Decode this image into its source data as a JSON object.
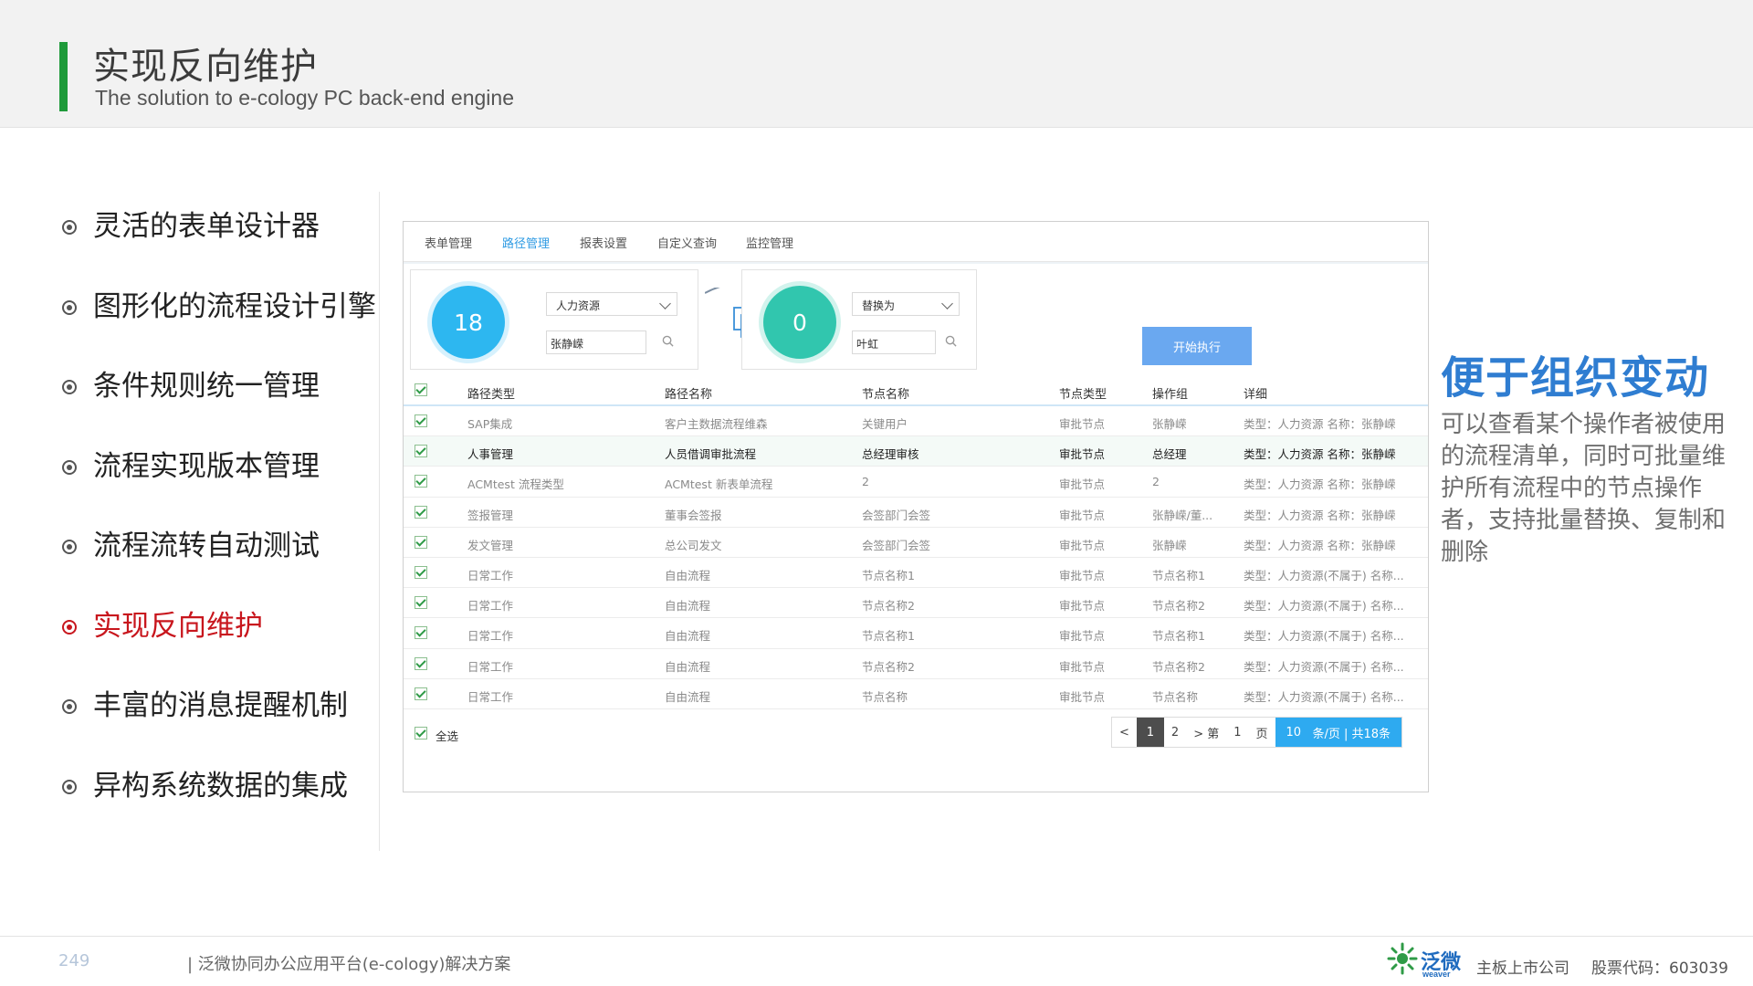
{
  "header": {
    "title": "实现反向维护",
    "subtitle": "The solution to e-cology PC back-end engine"
  },
  "menu": {
    "items": [
      {
        "label": "灵活的表单设计器",
        "active": false
      },
      {
        "label": "图形化的流程设计引擎",
        "active": false
      },
      {
        "label": "条件规则统一管理",
        "active": false
      },
      {
        "label": "流程实现版本管理",
        "active": false
      },
      {
        "label": "流程流转自动测试",
        "active": false
      },
      {
        "label": "实现反向维护",
        "active": true
      },
      {
        "label": "丰富的消息提醒机制",
        "active": false
      },
      {
        "label": "异构系统数据的集成",
        "active": false
      }
    ]
  },
  "app": {
    "tabs": [
      {
        "label": "表单管理",
        "active": false
      },
      {
        "label": "路径管理",
        "active": true
      },
      {
        "label": "报表设置",
        "active": false
      },
      {
        "label": "自定义查询",
        "active": false
      },
      {
        "label": "监控管理",
        "active": false
      }
    ],
    "source": {
      "count": "18",
      "select": "人力资源",
      "input": "张静嵘"
    },
    "target": {
      "count": "0",
      "select": "替换为",
      "input": "叶虹"
    },
    "execute_label": "开始执行",
    "columns": [
      "路径类型",
      "路径名称",
      "节点名称",
      "节点类型",
      "操作组",
      "详细"
    ],
    "rows": [
      [
        "SAP集成",
        "客户主数据流程维森",
        "关键用户",
        "审批节点",
        "张静嵘",
        "类型：人力资源  名称：张静嵘"
      ],
      [
        "人事管理",
        "人员借调审批流程",
        "总经理审核",
        "审批节点",
        "总经理",
        "类型：人力资源  名称：张静嵘"
      ],
      [
        "ACMtest 流程类型",
        "ACMtest 新表单流程",
        "2",
        "审批节点",
        "2",
        "类型：人力资源  名称：张静嵘"
      ],
      [
        "签报管理",
        "董事会签报",
        "会签部门会签",
        "审批节点",
        "张静嵘/董...",
        "类型：人力资源  名称：张静嵘"
      ],
      [
        "发文管理",
        "总公司发文",
        "会签部门会签",
        "审批节点",
        "张静嵘",
        "类型：人力资源  名称：张静嵘"
      ],
      [
        "日常工作",
        "自由流程",
        "节点名称1",
        "审批节点",
        "节点名称1",
        "类型：人力资源(不属于)  名称..."
      ],
      [
        "日常工作",
        "自由流程",
        "节点名称2",
        "审批节点",
        "节点名称2",
        "类型：人力资源(不属于)  名称..."
      ],
      [
        "日常工作",
        "自由流程",
        "节点名称1",
        "审批节点",
        "节点名称1",
        "类型：人力资源(不属于)  名称..."
      ],
      [
        "日常工作",
        "自由流程",
        "节点名称2",
        "审批节点",
        "节点名称2",
        "类型：人力资源(不属于)  名称..."
      ],
      [
        "日常工作",
        "自由流程",
        "节点名称",
        "审批节点",
        "节点名称",
        "类型：人力资源(不属于)  名称..."
      ]
    ],
    "select_all_label": "全选",
    "pager": {
      "prev": "<",
      "page1": "1",
      "page2": "2",
      "next": "> 第",
      "jump": "1",
      "page_unit": "页",
      "size": "10",
      "size_label": "条/页 | 共18条"
    }
  },
  "right": {
    "title": "便于组织变动",
    "description": "可以查看某个操作者被使用的流程清单，同时可批量维护所有流程中的节点操作者，支持批量替换、复制和删除"
  },
  "footer": {
    "page_number": "249",
    "text": "| 泛微协同办公应用平台(e-cology)解决方案",
    "logo_text": "泛微",
    "logo_sub": "weaver",
    "company": "主板上市公司",
    "stock": "股票代码：603039"
  },
  "colors": {
    "accent_green": "#1f9a3a",
    "active_red": "#c8161d",
    "tab_blue": "#2f9be3",
    "title_blue": "#2f7dd1"
  }
}
